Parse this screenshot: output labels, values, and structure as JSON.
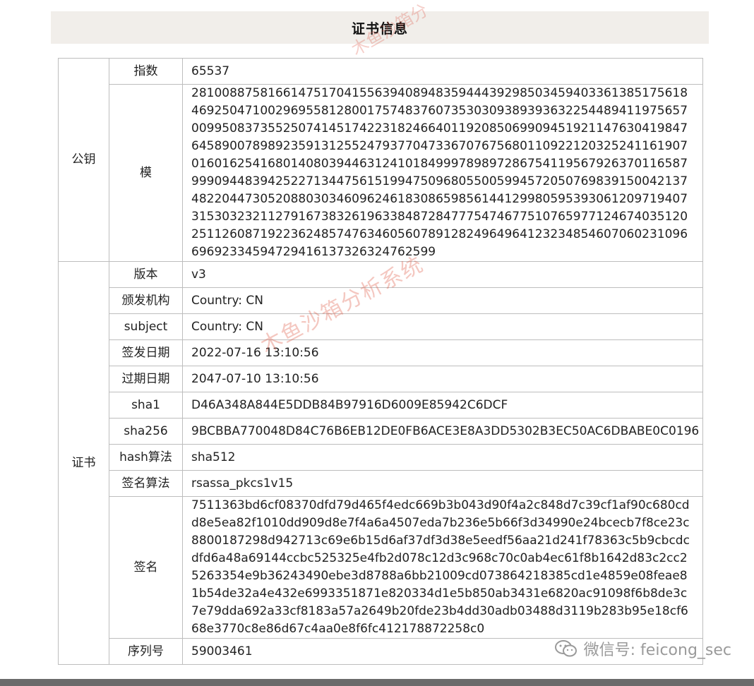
{
  "title": "证书信息",
  "public_key": {
    "group_label": "公钥",
    "rows": [
      {
        "label": "指数",
        "value": "65537"
      },
      {
        "label": "模",
        "value": "28100887581661475170415563940894835944439298503459403361385175618469250471002969558128001757483760735303093893936322544894119756570099508373552507414517422318246640119208506990945192114763041984764589007898923591312552479377047336707675680110922120325241161907016016254168014080394463124101849997898972867541195679263701165879990944839425227134475615199475096805500599457205076983915004213748220447305208803034609624618308659856144129980595393061209719407315303232112791673832619633848728477754746775107659771246740351202511260871922362485747634605607891282496496412323485460706023109669692334594729416137326324762599"
      }
    ]
  },
  "certificate": {
    "group_label": "证书",
    "rows": [
      {
        "label": "版本",
        "value": "v3"
      },
      {
        "label": "颁发机构",
        "value": "Country: CN"
      },
      {
        "label": "subject",
        "value": "Country: CN"
      },
      {
        "label": "签发日期",
        "value": "2022-07-16 13:10:56"
      },
      {
        "label": "过期日期",
        "value": "2047-07-10 13:10:56"
      },
      {
        "label": "sha1",
        "value": "D46A348A844E5DDB84B97916D6009E85942C6DCF"
      },
      {
        "label": "sha256",
        "value": "9BCBBA770048D84C76B6EB12DE0FB6ACE3E8A3DD5302B3EC50AC6DBABE0C0196"
      },
      {
        "label": "hash算法",
        "value": "sha512"
      },
      {
        "label": "签名算法",
        "value": "rsassa_pkcs1v15"
      },
      {
        "label": "签名",
        "value": "7511363bd6cf08370dfd79d465f4edc669b3b043d90f4a2c848d7c39cf1af90c680cdd8e5ea82f1010dd909d8e7f4a6a4507eda7b236e5b66f3d34990e24bcecb7f8ce23c8800187298d942713c69e6b15d6af37df3d38e5eedf56aa21d241f78363c5b9cbcdcdfd6a48a69144ccbc525325e4fb2d078c12d3c968c70c0ab4ec61f8b1642d83c2cc25263354e9b36243490ebe3d8788a6bb21009cd073864218385cd1e4859e08feae81b54de32a4e432e6993351871e820334d1e5b850ab3431e6820ac91098f6b8de3c7e79dda692a33cf8183a57a2649b20fde23b4dd30adb03488d3119b283b95e18cf668e3770c8e86d67c4aa0e8f6fc412178872258c0"
      },
      {
        "label": "序列号",
        "value": "59003461"
      }
    ]
  },
  "watermark": {
    "main": "木鱼沙箱分析系统",
    "top": "木鱼沙箱分",
    "color": "#dc503c"
  },
  "wechat_mark": {
    "text": "微信号: feicong_sec",
    "icon": "wechat-icon"
  }
}
